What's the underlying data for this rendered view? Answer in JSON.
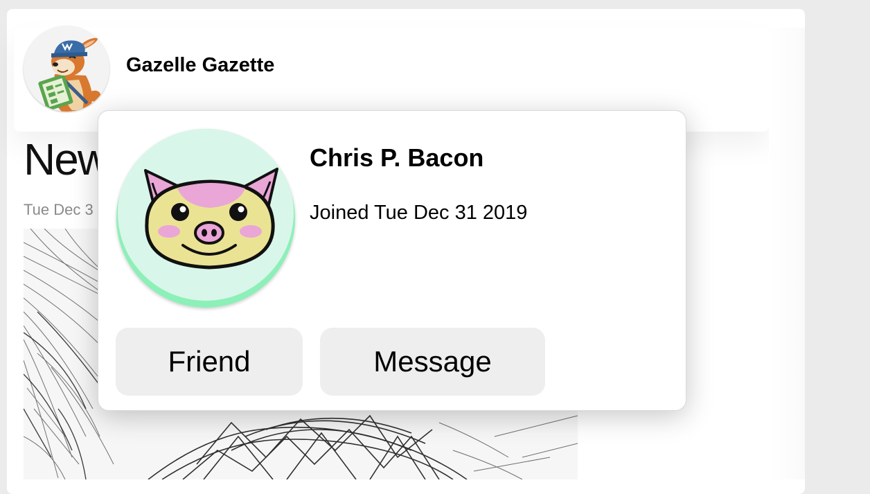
{
  "feed": {
    "page_name": "Gazelle Gazette",
    "post_title": "New",
    "post_date": "Tue Dec 3"
  },
  "profile_popup": {
    "name": "Chris P. Bacon",
    "joined": "Joined Tue Dec 31 2019",
    "buttons": {
      "friend": "Friend",
      "message": "Message"
    }
  },
  "icons": {
    "page_avatar": "gazelle-mascot-icon",
    "user_avatar": "pig-face-icon"
  },
  "colors": {
    "button_bg": "#eeeeee",
    "avatar_bg": "#d9f6ea",
    "avatar_rim": "#8cf0b8",
    "pig_face": "#ebe394",
    "pig_pink": "#e9a6d6"
  }
}
